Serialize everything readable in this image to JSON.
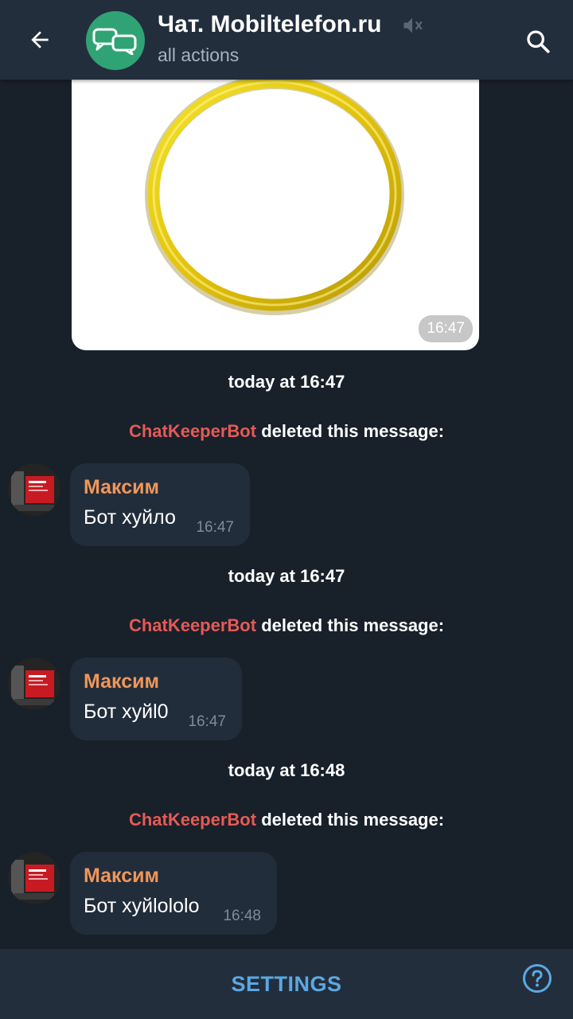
{
  "header": {
    "title": "Чат. Mobiltelefon.ru",
    "subtitle": "all actions",
    "back_icon": "arrow-left-icon",
    "group_icon": "chat-bubbles-icon",
    "mute_icon": "muted-speaker-icon",
    "search_icon": "search-icon",
    "avatar_color": "#30a374"
  },
  "image_message": {
    "time": "16:47",
    "content_icon": "gold-ring-image"
  },
  "feed": [
    {
      "date": "today at 16:47",
      "bot_name": "ChatKeeperBot",
      "action": " deleted this message:",
      "sender": "Максим",
      "text": "Бот хуйло",
      "time": "16:47"
    },
    {
      "date": "today at 16:47",
      "bot_name": "ChatKeeperBot",
      "action": " deleted this message:",
      "sender": "Максим",
      "text": "Бот хуйl0",
      "time": "16:47"
    },
    {
      "date": "today at 16:48",
      "bot_name": "ChatKeeperBot",
      "action": " deleted this message:",
      "sender": "Максим",
      "text": "Бот хуйlololo",
      "time": "16:48"
    }
  ],
  "footer": {
    "settings_label": "SETTINGS",
    "help_icon": "help-circle-icon"
  },
  "colors": {
    "background": "#18202a",
    "header": "#232e3c",
    "bubble": "#222d3b",
    "sender_name": "#f0965a",
    "bot_name": "#e55a55",
    "accent": "#5ba8e3"
  }
}
